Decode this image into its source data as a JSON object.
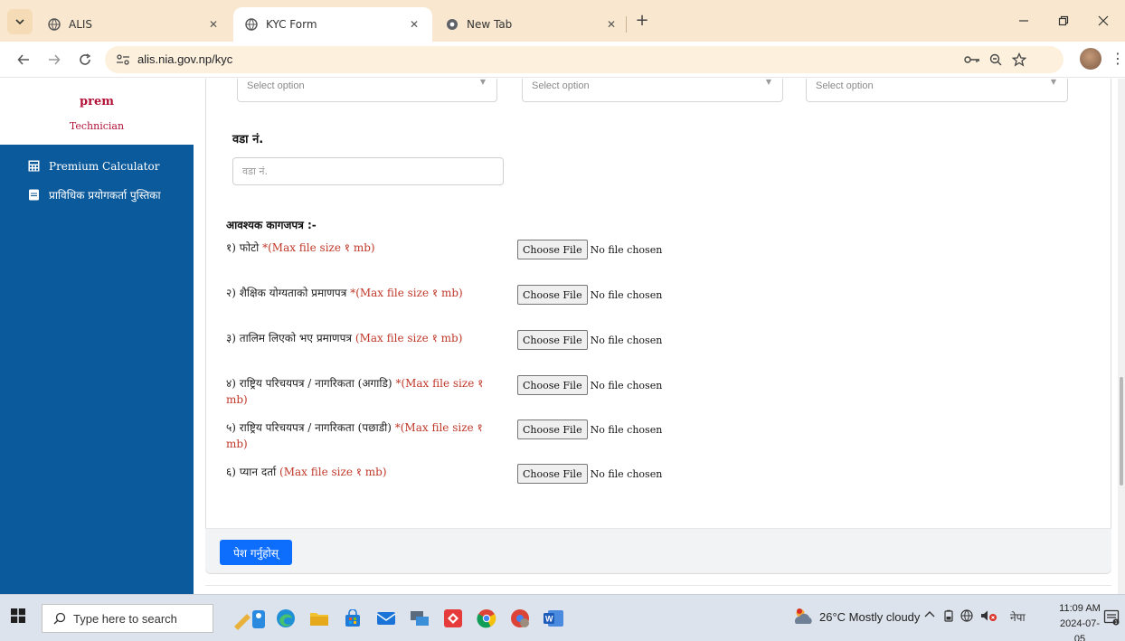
{
  "browser": {
    "tabs": [
      {
        "title": "ALIS",
        "active": false
      },
      {
        "title": "KYC Form",
        "active": true
      },
      {
        "title": "New Tab",
        "active": false
      }
    ],
    "url": "alis.nia.gov.np/kyc"
  },
  "sidebar": {
    "user_name": "prem",
    "user_role": "Technician",
    "items": [
      {
        "label": "Premium Calculator",
        "icon": "calculator-icon"
      },
      {
        "label": "प्राविधिक प्रयोगकर्ता पुस्तिका",
        "icon": "book-icon"
      }
    ]
  },
  "form": {
    "selects": [
      {
        "placeholder": "Select option"
      },
      {
        "placeholder": "Select option"
      },
      {
        "placeholder": "Select option"
      }
    ],
    "ward_label": "वडा नं.",
    "ward_placeholder": "वडा नं.",
    "docs_heading": "आवश्यक कागजपत्र :-",
    "documents": [
      {
        "label": "१) फोटो",
        "hint": "*(Max file size १ mb)"
      },
      {
        "label": "२) शैक्षिक योग्यताको प्रमाणपत्र",
        "hint": "*(Max file size १ mb)"
      },
      {
        "label": "३) तालिम लिएको भए प्रमाणपत्र",
        "hint": "(Max file size १ mb)"
      },
      {
        "label": "४) राष्ट्रिय परिचयपत्र / नागरिकता (अगाडि)",
        "hint": "*(Max file size १ mb)"
      },
      {
        "label": "५) राष्ट्रिय परिचयपत्र / नागरिकता (पछाडी)",
        "hint": "*(Max file size १ mb)"
      },
      {
        "label": "६) प्यान दर्ता",
        "hint": "(Max file size १ mb)"
      }
    ],
    "file_button_label": "Choose File",
    "file_status": "No file chosen",
    "submit_label": "पेश गर्नुहोस्"
  },
  "taskbar": {
    "search_placeholder": "Type here to search",
    "weather": "26°C  Mostly cloudy",
    "lang": "नेपा",
    "time": "11:09 AM",
    "date": "2024-07-05"
  }
}
